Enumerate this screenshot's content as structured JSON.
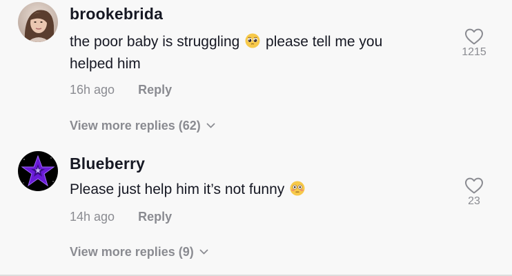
{
  "comments": [
    {
      "username": "brookebrida",
      "text_before": "the poor baby is struggling",
      "emoji": "pleading-face",
      "text_after": "please tell me you helped him",
      "time": "16h ago",
      "reply_label": "Reply",
      "view_more": "View more replies (62)",
      "like_count": "1215"
    },
    {
      "username": "Blueberry",
      "text_before": "Please just help him it’s not funny",
      "emoji": "flushed-face",
      "text_after": "",
      "time": "14h ago",
      "reply_label": "Reply",
      "view_more": "View more replies (9)",
      "like_count": "23"
    }
  ],
  "colors": {
    "background": "#f8f8f8",
    "text": "#161823",
    "muted": "#8a8b91",
    "star": "#6a1bd6"
  }
}
